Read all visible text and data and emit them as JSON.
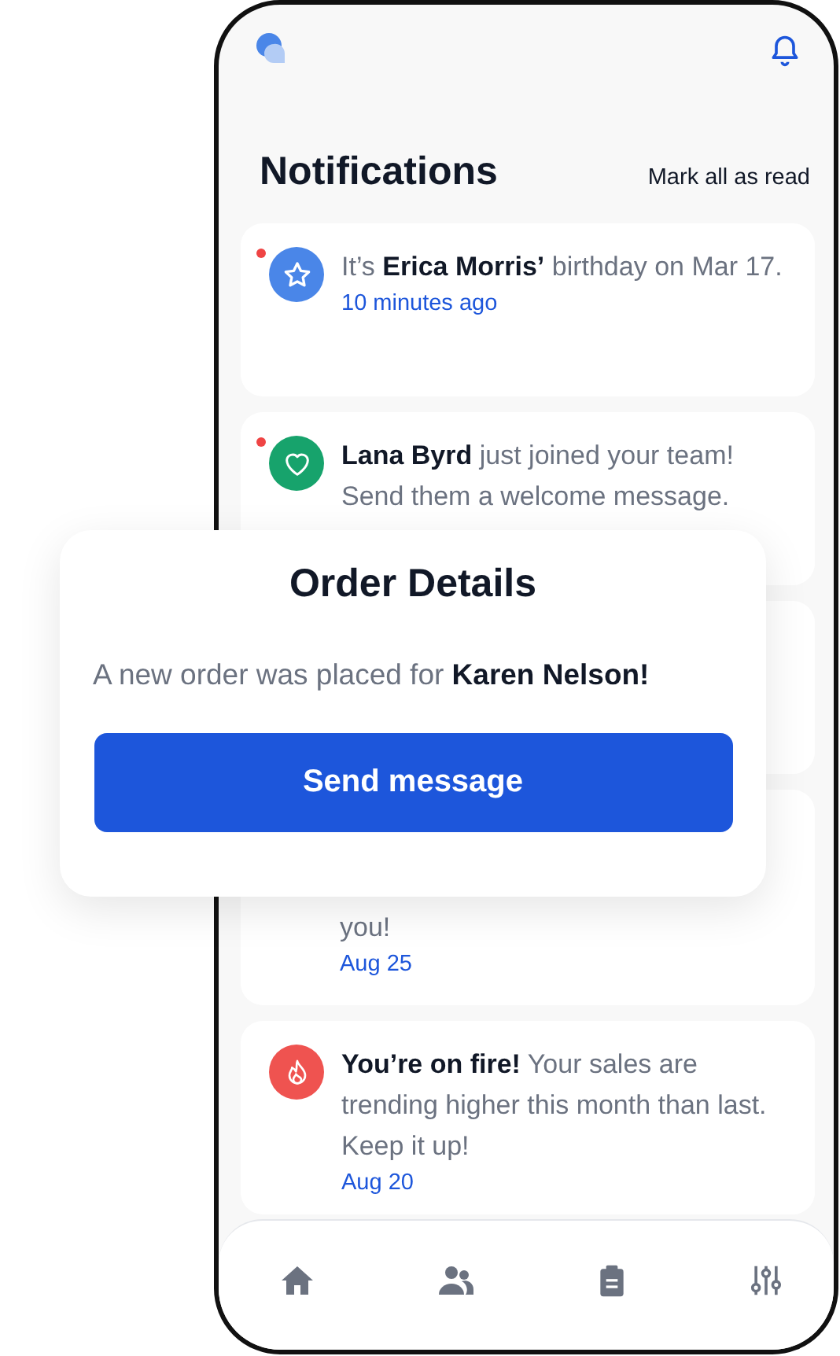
{
  "header": {
    "title": "Notifications",
    "action": "Mark all as read"
  },
  "notifications": [
    {
      "kind": "birthday",
      "color": "#4a86e8",
      "unread": true,
      "text": "It’s **Erica Morris’** birthday on Mar 17.",
      "time": "10 minutes ago"
    },
    {
      "kind": "join",
      "color": "#17a36c",
      "unread": true,
      "text": "**Lana Byrd** just joined your team! Send them a welcome message."
    },
    {
      "kind": "covered"
    },
    {
      "kind": "tail",
      "text": "you!",
      "time": "Aug 25"
    },
    {
      "kind": "sales",
      "color": "#ef5350",
      "unread": false,
      "text": "**You’re on fire!** Your sales are trending higher this month than last. Keep it up!",
      "time": "Aug 20"
    }
  ],
  "dialog": {
    "title": "Order Details",
    "text": "A new order was placed for **Karen Nelson!**",
    "button": "Send message"
  }
}
